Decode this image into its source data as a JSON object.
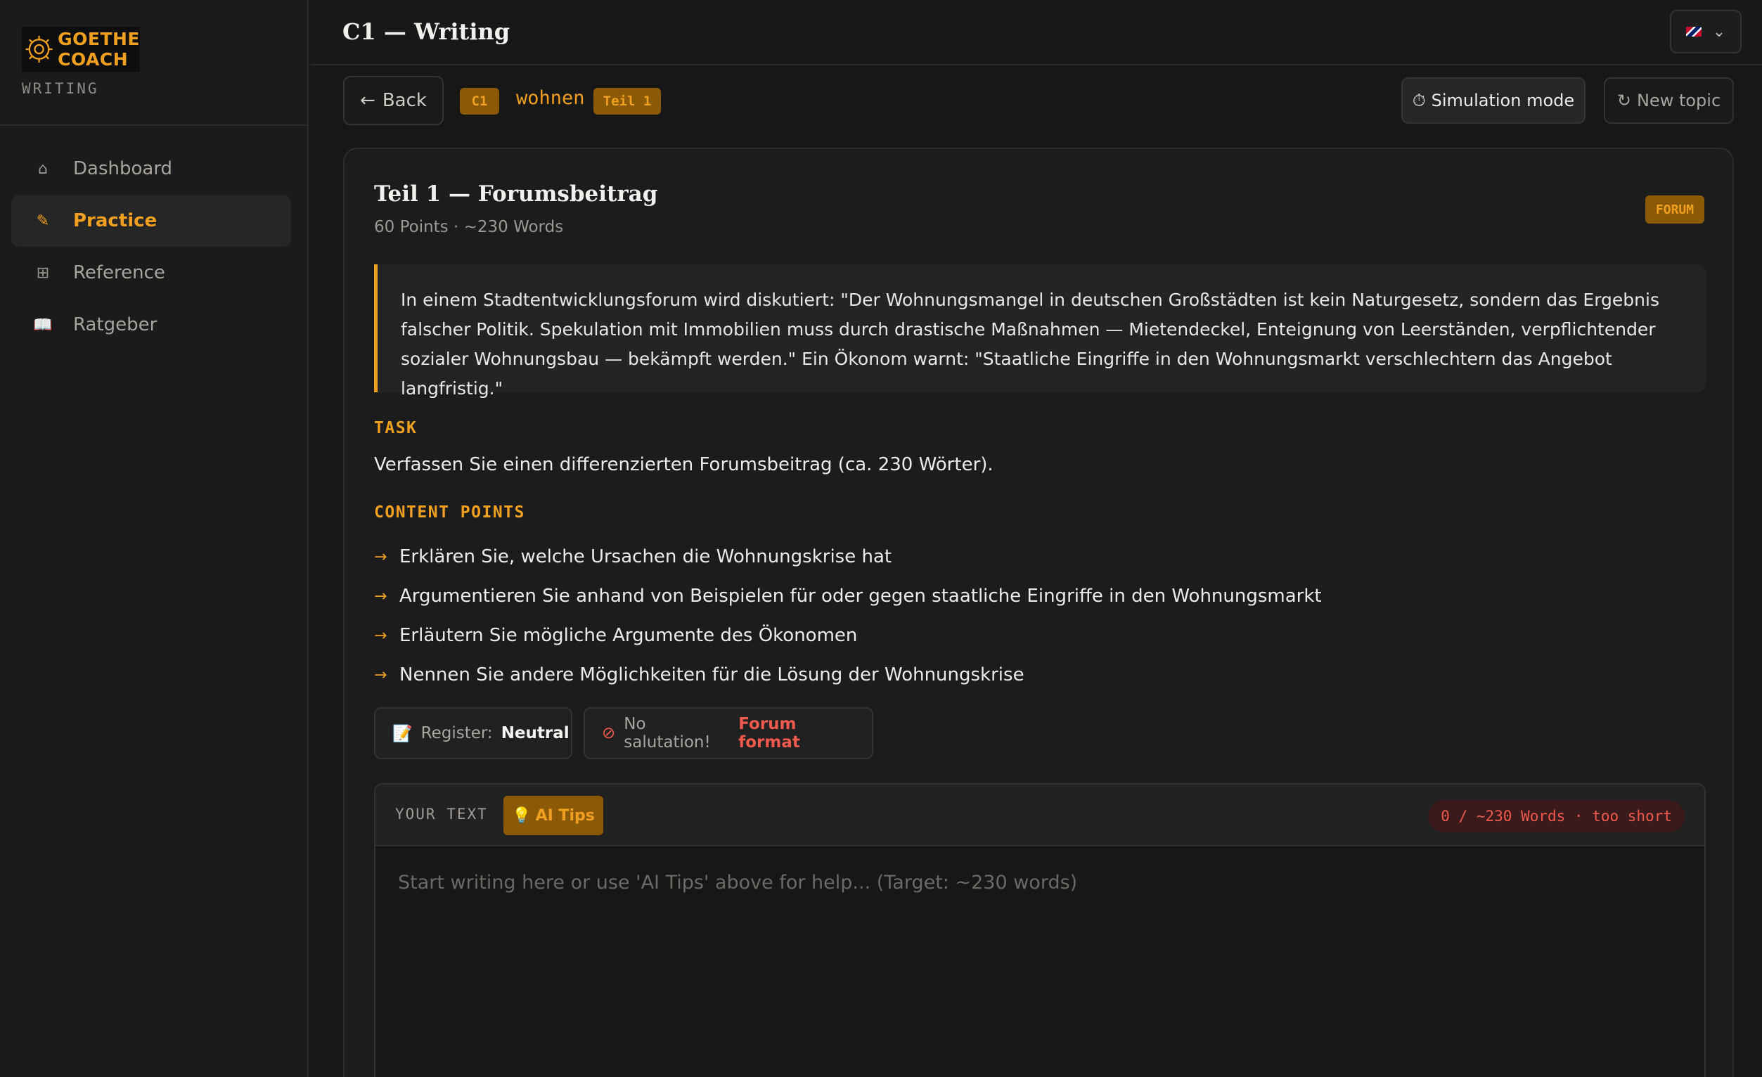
{
  "sidebar": {
    "logo_line1": "GOETHE",
    "logo_line2": "COACH",
    "subtitle": "WRITING",
    "items": [
      {
        "label": "Dashboard",
        "icon": "home-icon",
        "glyph": "⌂"
      },
      {
        "label": "Practice",
        "icon": "pencil-icon",
        "glyph": "✎"
      },
      {
        "label": "Reference",
        "icon": "grid-icon",
        "glyph": "⊞"
      },
      {
        "label": "Ratgeber",
        "icon": "book-icon",
        "glyph": "📖"
      }
    ]
  },
  "header": {
    "title": "C1 — Writing"
  },
  "toolbar": {
    "back_label": "Back",
    "level": "C1",
    "topic": "wohnen",
    "part": "Teil 1",
    "simulation_label": "Simulation mode",
    "new_topic_label": "New topic"
  },
  "card": {
    "title": "Teil 1 — Forumsbeitrag",
    "meta": "60 Points · ~230 Words",
    "badge": "FORUM",
    "prompt": "In einem Stadtentwicklungsforum wird diskutiert: \"Der Wohnungsmangel in deutschen Großstädten ist kein Naturgesetz, sondern das Ergebnis falscher Politik. Spekulation mit Immobilien muss durch drastische Maßnahmen — Mietendeckel, Enteignung von Leerständen, verpflichtender sozialer Wohnungsbau — bekämpft werden.\" Ein Ökonom warnt: \"Staatliche Eingriffe in den Wohnungsmarkt verschlechtern das Angebot langfristig.\"",
    "task_label": "TASK",
    "task_text": "Verfassen Sie einen differenzierten Forumsbeitrag (ca. 230 Wörter).",
    "points_label": "CONTENT POINTS",
    "points": [
      "Erklären Sie, welche Ursachen die Wohnungskrise hat",
      "Argumentieren Sie anhand von Beispielen für oder gegen staatliche Eingriffe in den Wohnungsmarkt",
      "Erläutern Sie mögliche Argumente des Ökonomen",
      "Nennen Sie andere Möglichkeiten für die Lösung der Wohnungskrise"
    ],
    "register_prefix": "Register:",
    "register_value": "Neutral",
    "salutation_prefix": "No salutation!",
    "salutation_value": "Forum format"
  },
  "editor": {
    "label": "YOUR TEXT",
    "ai_tips_label": "AI Tips",
    "word_count": "0 / ~230 Words · too short",
    "value": "",
    "placeholder": "Start writing here or use 'AI Tips' above for help... (Target: ~230 words)"
  },
  "colors": {
    "accent": "#f0a020",
    "danger": "#ef5a4f",
    "background": "#171717"
  }
}
